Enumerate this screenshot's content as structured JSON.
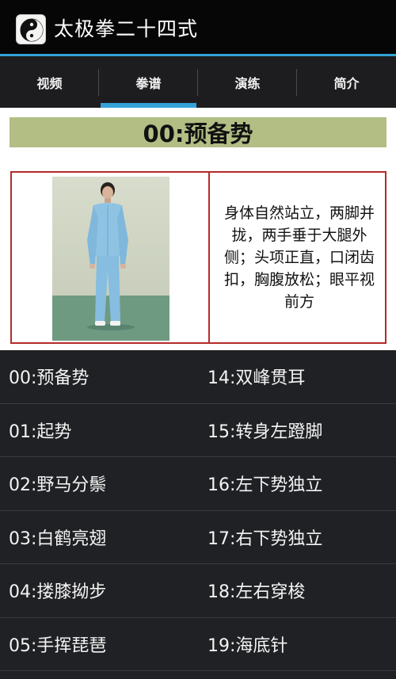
{
  "app": {
    "title": "太极拳二十四式",
    "icon": "yin-yang-icon",
    "accent_color": "#33a3d8"
  },
  "tabs": [
    {
      "label": "视频",
      "active": false
    },
    {
      "label": "拳谱",
      "active": true
    },
    {
      "label": "演练",
      "active": false
    },
    {
      "label": "简介",
      "active": false
    }
  ],
  "pose": {
    "title": "00:预备势",
    "description": "身体自然站立，两脚并拢，两手垂于大腿外侧；头项正直，口闭齿扣，胸腹放松；眼平视前方"
  },
  "moves_left": [
    "00:预备势",
    "01:起势",
    "02:野马分鬃",
    "03:白鹤亮翅",
    "04:搂膝拗步",
    "05:手挥琵琶"
  ],
  "moves_right": [
    "14:双峰贯耳",
    "15:转身左蹬脚",
    "16:左下势独立",
    "17:右下势独立",
    "18:左右穿梭",
    "19:海底针"
  ]
}
